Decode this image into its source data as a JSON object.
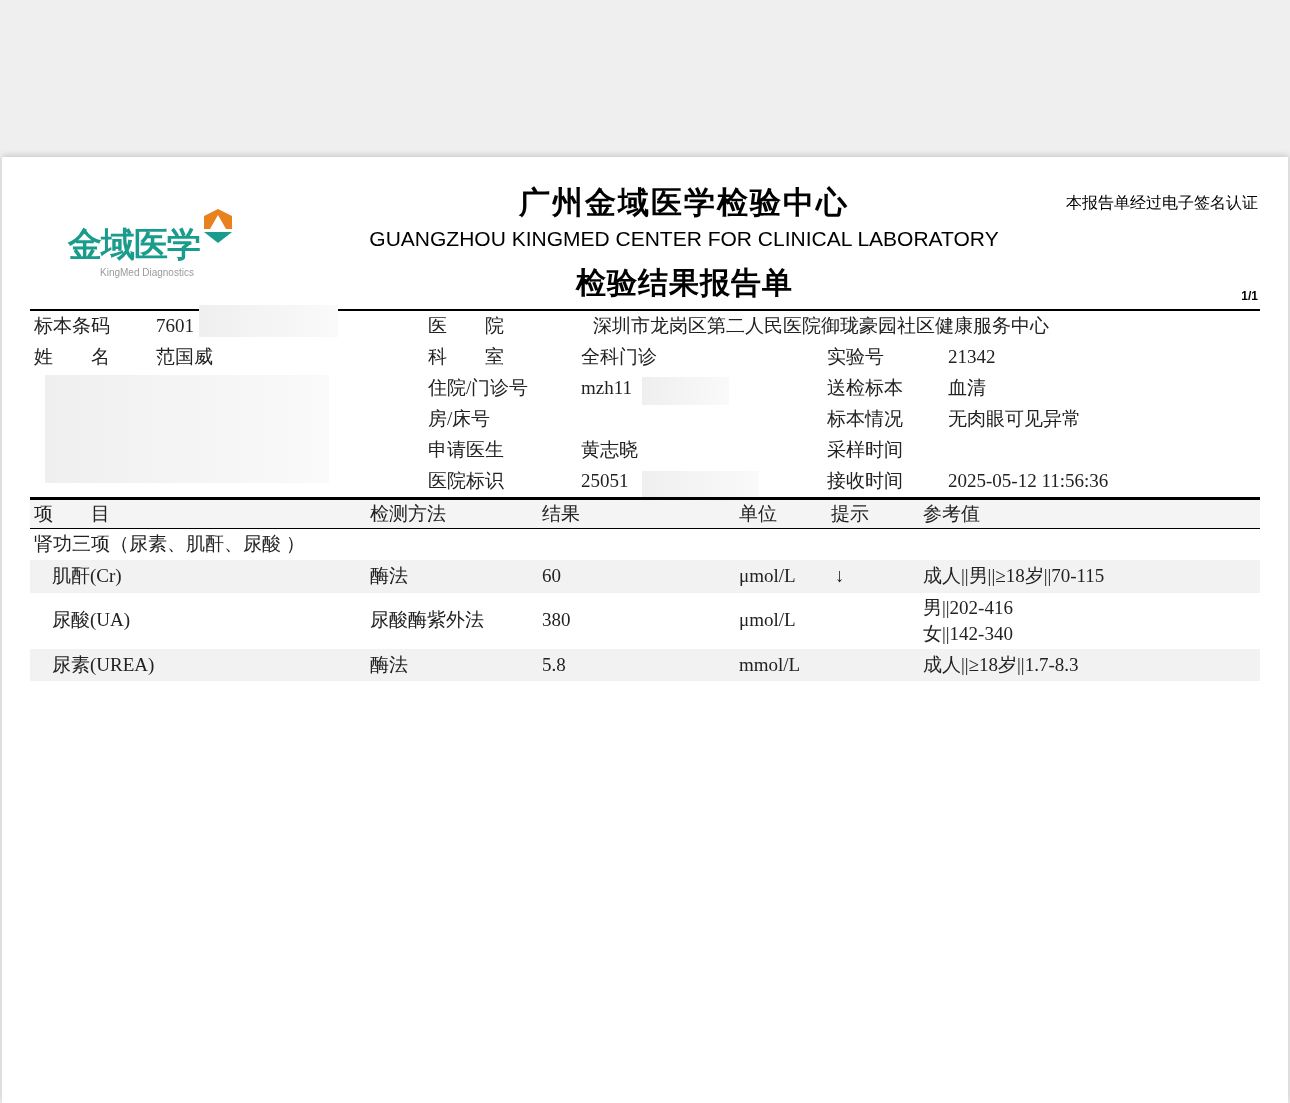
{
  "header": {
    "logo_text": "金域医学",
    "logo_subtext": "KingMed Diagnostics",
    "title": "广州金域医学检验中心",
    "title_en": "GUANGZHOU KINGMED CENTER FOR CLINICAL LABORATORY",
    "subtitle": "检验结果报告单",
    "signature_note": "本报告单经过电子签名认证",
    "page": "1/1"
  },
  "info_rows": [
    {
      "cells": [
        {
          "label": "标本条码",
          "value": "7601"
        },
        {
          "label": "医　　院",
          "value": "深圳市龙岗区第二人民医院御珑豪园社区健康服务中心"
        },
        null
      ]
    },
    {
      "cells": [
        {
          "label": "姓　　名",
          "value": "范国威"
        },
        {
          "label": "科　　室",
          "value": "全科门诊"
        },
        {
          "label": "实验号",
          "value": "21342"
        }
      ]
    },
    {
      "cells": [
        null,
        {
          "label": "住院/门诊号",
          "value": "mzh11"
        },
        {
          "label": "送检标本",
          "value": "血清"
        }
      ]
    },
    {
      "cells": [
        null,
        {
          "label": "房/床号"
        },
        {
          "label": "标本情况",
          "value": "无肉眼可见异常"
        }
      ]
    },
    {
      "cells": [
        null,
        {
          "label": "申请医生",
          "value": "黄志晓"
        },
        {
          "label": "采样时间"
        }
      ]
    },
    {
      "cells": [
        null,
        {
          "label": "医院标识",
          "value": "25051"
        },
        {
          "label": "接收时间",
          "value": "2025-05-12 11:56:36"
        }
      ]
    }
  ],
  "table": {
    "columns": [
      "项　　目",
      "检测方法",
      "结果",
      "单位",
      "提示",
      "参考值"
    ],
    "group": "肾功三项（尿素、肌酐、尿酸 ）",
    "rows": [
      {
        "name": "肌酐(Cr)",
        "method": "酶法",
        "result": "60",
        "unit": "μmol/L",
        "flag": "↓",
        "reference": [
          "成人||男||≥18岁||70-115"
        ]
      },
      {
        "name": "尿酸(UA)",
        "method": "尿酸酶紫外法",
        "result": "380",
        "unit": "μmol/L",
        "flag": "",
        "reference": [
          "男||202-416",
          "女||142-340"
        ]
      },
      {
        "name": "尿素(UREA)",
        "method": "酶法",
        "result": "5.8",
        "unit": "mmol/L",
        "flag": "",
        "reference": [
          "成人||≥18岁||1.7-8.3"
        ]
      }
    ]
  }
}
